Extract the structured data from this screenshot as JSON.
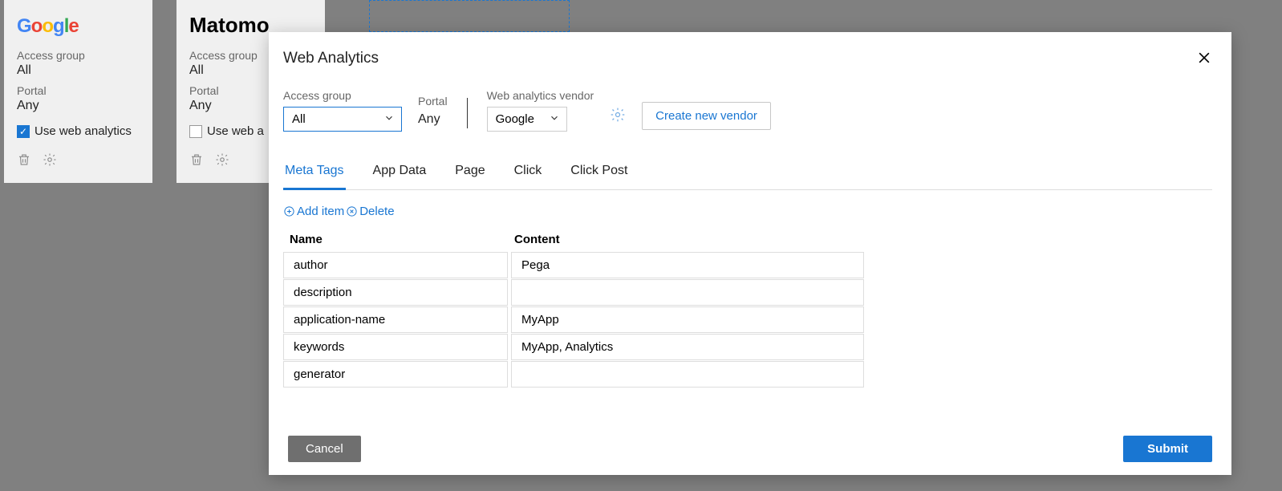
{
  "cards": [
    {
      "logo_type": "google",
      "access_group_label": "Access group",
      "access_group_value": "All",
      "portal_label": "Portal",
      "portal_value": "Any",
      "checkbox_label": "Use web analytics",
      "checked": true
    },
    {
      "logo_type": "matomo",
      "logo_text": "Matomo",
      "access_group_label": "Access group",
      "access_group_value": "All",
      "portal_label": "Portal",
      "portal_value": "Any",
      "checkbox_label": "Use web a",
      "checked": false
    }
  ],
  "modal": {
    "title": "Web Analytics",
    "access_group_label": "Access group",
    "access_group_value": "All",
    "portal_label": "Portal",
    "portal_value": "Any",
    "vendor_label": "Web analytics vendor",
    "vendor_value": "Google",
    "create_vendor_label": "Create new vendor",
    "tabs": [
      "Meta Tags",
      "App Data",
      "Page",
      "Click",
      "Click Post"
    ],
    "active_tab": 0,
    "toolbar": {
      "add_item": "Add item",
      "delete": "Delete"
    },
    "table": {
      "headers": {
        "name": "Name",
        "content": "Content"
      },
      "rows": [
        {
          "name": "author",
          "content": "Pega"
        },
        {
          "name": "description",
          "content": ""
        },
        {
          "name": "application-name",
          "content": "MyApp"
        },
        {
          "name": "keywords",
          "content": "MyApp, Analytics"
        },
        {
          "name": "generator",
          "content": ""
        }
      ]
    },
    "footer": {
      "cancel": "Cancel",
      "submit": "Submit"
    }
  }
}
